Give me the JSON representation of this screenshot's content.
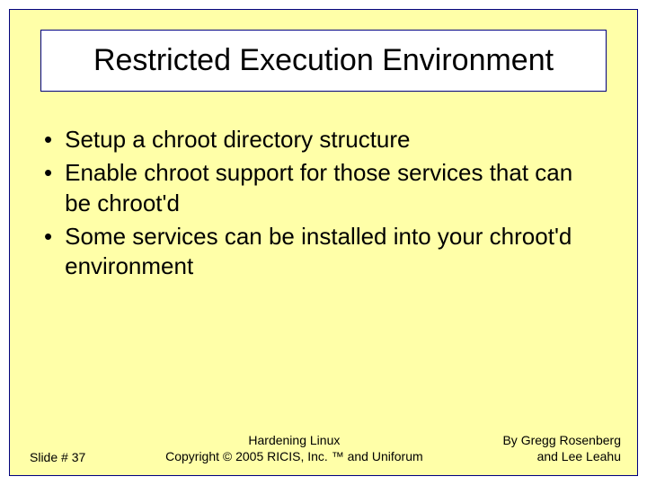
{
  "slide": {
    "title": "Restricted Execution Environment",
    "bullets": [
      "Setup a chroot directory structure",
      "Enable chroot support for those services that can be chroot'd",
      "Some services can be installed into your chroot'd environment"
    ],
    "footer": {
      "left": "Slide # 37",
      "center_line1": "Hardening Linux",
      "center_line2": "Copyright © 2005 RICIS, Inc. ™ and Uniforum",
      "right_line1": "By Gregg Rosenberg",
      "right_line2": "and Lee Leahu"
    }
  }
}
